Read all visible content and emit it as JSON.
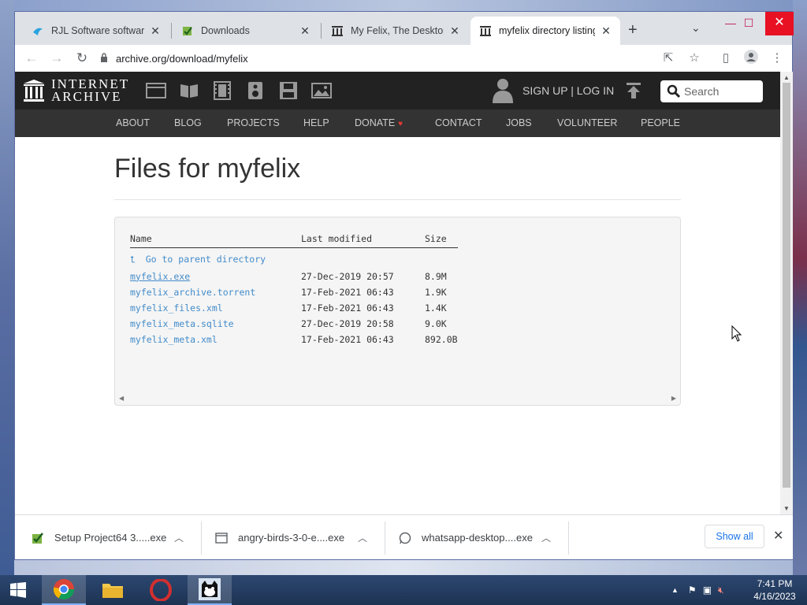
{
  "browser": {
    "tabs": [
      {
        "label": "RJL Software software c",
        "icon": "rjl-favicon",
        "active": false
      },
      {
        "label": "Downloads",
        "icon": "downloads-favicon",
        "active": false
      },
      {
        "label": "My Felix, The Desktop C",
        "icon": "archive-favicon",
        "active": false
      },
      {
        "label": "myfelix directory listing",
        "icon": "archive-favicon",
        "active": true
      }
    ],
    "new_tab": "+",
    "url": "archive.org/download/myfelix"
  },
  "ia_header": {
    "logo_line1": "INTERNET",
    "logo_line2": "ARCHIVE",
    "signin": "SIGN UP | LOG IN",
    "search_placeholder": "Search",
    "nav": [
      "ABOUT",
      "BLOG",
      "PROJECTS",
      "HELP",
      "DONATE",
      "CONTACT",
      "JOBS",
      "VOLUNTEER",
      "PEOPLE"
    ]
  },
  "page": {
    "title": "Files for myfelix",
    "columns": {
      "name": "Name",
      "modified": "Last modified",
      "size": "Size"
    },
    "parent_link": "Go to parent directory",
    "files": [
      {
        "name": "myfelix.exe",
        "modified": "27-Dec-2019 20:57",
        "size": "8.9M"
      },
      {
        "name": "myfelix_archive.torrent",
        "modified": "17-Feb-2021 06:43",
        "size": "1.9K"
      },
      {
        "name": "myfelix_files.xml",
        "modified": "17-Feb-2021 06:43",
        "size": "1.4K"
      },
      {
        "name": "myfelix_meta.sqlite",
        "modified": "27-Dec-2019 20:58",
        "size": "9.0K"
      },
      {
        "name": "myfelix_meta.xml",
        "modified": "17-Feb-2021 06:43",
        "size": "892.0B"
      }
    ]
  },
  "downloads": {
    "items": [
      {
        "name": "Setup Project64 3.....exe",
        "icon": "installer-icon"
      },
      {
        "name": "angry-birds-3-0-e....exe",
        "icon": "exe-icon"
      },
      {
        "name": "whatsapp-desktop....exe",
        "icon": "whatsapp-icon"
      }
    ],
    "show_all": "Show all"
  },
  "taskbar": {
    "time": "7:41 PM",
    "date": "4/16/2023"
  },
  "colors": {
    "ia_top": "#222222",
    "ia_nav": "#333333",
    "link": "#428bca",
    "close_red": "#e81123"
  }
}
